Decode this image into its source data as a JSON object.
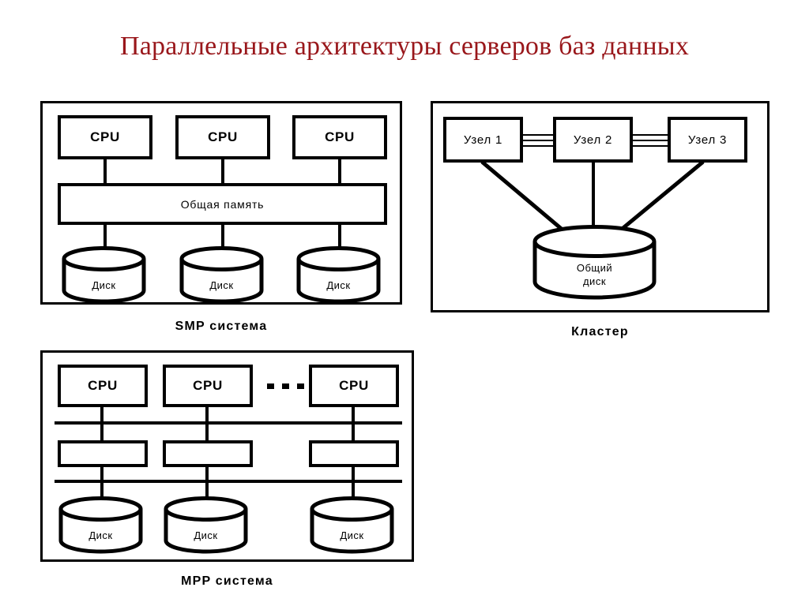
{
  "slide": {
    "title": "Параллельные архитектуры серверов баз данных",
    "title_color": "#99171b",
    "background": "#ffffff",
    "line_color": "#000000"
  },
  "diagrams": [
    {
      "id": "smp",
      "caption": "SMP система",
      "cpus": [
        {
          "label": "CPU"
        },
        {
          "label": "CPU"
        },
        {
          "label": "CPU"
        }
      ],
      "memory": {
        "label": "Общая память"
      },
      "disks": [
        {
          "label": "Диск"
        },
        {
          "label": "Диск"
        },
        {
          "label": "Диск"
        }
      ]
    },
    {
      "id": "cluster",
      "caption": "Кластер",
      "nodes": [
        {
          "label": "Узел 1"
        },
        {
          "label": "Узел 2"
        },
        {
          "label": "Узел 3"
        }
      ],
      "shared_disk": {
        "line1": "Общий",
        "line2": "диск"
      }
    },
    {
      "id": "mpp",
      "caption": "MPP система",
      "cpus": [
        {
          "label": "CPU"
        },
        {
          "label": "CPU"
        },
        {
          "label": "CPU"
        }
      ],
      "ellipsis": "• • •",
      "memories": [
        {
          "label": ""
        },
        {
          "label": ""
        },
        {
          "label": ""
        }
      ],
      "disks": [
        {
          "label": "Диск"
        },
        {
          "label": "Диск"
        },
        {
          "label": "Диск"
        }
      ]
    }
  ]
}
